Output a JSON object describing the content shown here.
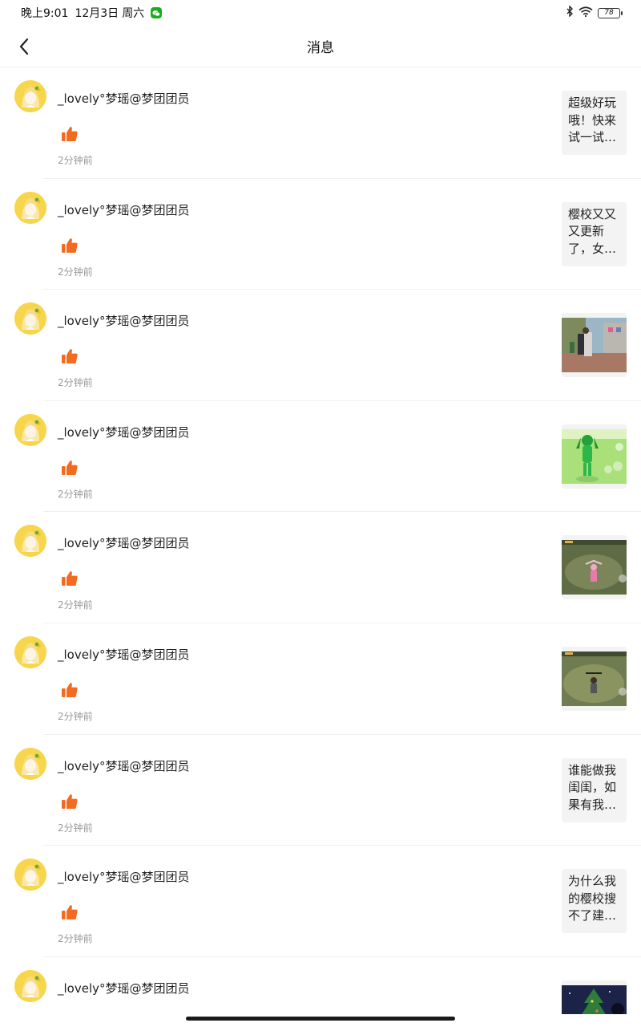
{
  "status_bar": {
    "time": "晚上9:01",
    "date": "12月3日",
    "weekday": "周六",
    "battery": "78",
    "icons": [
      "wechat-icon",
      "bluetooth-icon",
      "wifi-icon",
      "battery-icon"
    ]
  },
  "header": {
    "title": "消息",
    "back_icon": "chevron-left-icon"
  },
  "colors": {
    "like": "#f26b21",
    "time_text": "#999999",
    "thumb_bg": "#f3f3f3"
  },
  "notifications": [
    {
      "user": "_lovely°梦瑶@梦团团员",
      "time": "2分钟前",
      "thumb_type": "text",
      "thumb_lines": [
        "超级好玩",
        "哦！快来",
        "试一试…"
      ]
    },
    {
      "user": "_lovely°梦瑶@梦团团员",
      "time": "2分钟前",
      "thumb_type": "text",
      "thumb_lines": [
        "樱校又又",
        "又更新",
        "了，女…"
      ]
    },
    {
      "user": "_lovely°梦瑶@梦团团员",
      "time": "2分钟前",
      "thumb_type": "image",
      "thumb_scene": "street-scene"
    },
    {
      "user": "_lovely°梦瑶@梦团团员",
      "time": "2分钟前",
      "thumb_type": "image",
      "thumb_scene": "green-character"
    },
    {
      "user": "_lovely°梦瑶@梦团团员",
      "time": "2分钟前",
      "thumb_type": "image",
      "thumb_scene": "grass-field-pink"
    },
    {
      "user": "_lovely°梦瑶@梦团团员",
      "time": "2分钟前",
      "thumb_type": "image",
      "thumb_scene": "grass-field-dark"
    },
    {
      "user": "_lovely°梦瑶@梦团团员",
      "time": "2分钟前",
      "thumb_type": "text",
      "thumb_lines": [
        "谁能做我",
        "闺闺，如",
        "果有我…"
      ]
    },
    {
      "user": "_lovely°梦瑶@梦团团员",
      "time": "2分钟前",
      "thumb_type": "text",
      "thumb_lines": [
        "为什么我",
        "的樱校搜",
        "不了建…"
      ]
    },
    {
      "user": "_lovely°梦瑶@梦团团员",
      "time": "",
      "thumb_type": "image",
      "thumb_scene": "night-tree"
    }
  ]
}
